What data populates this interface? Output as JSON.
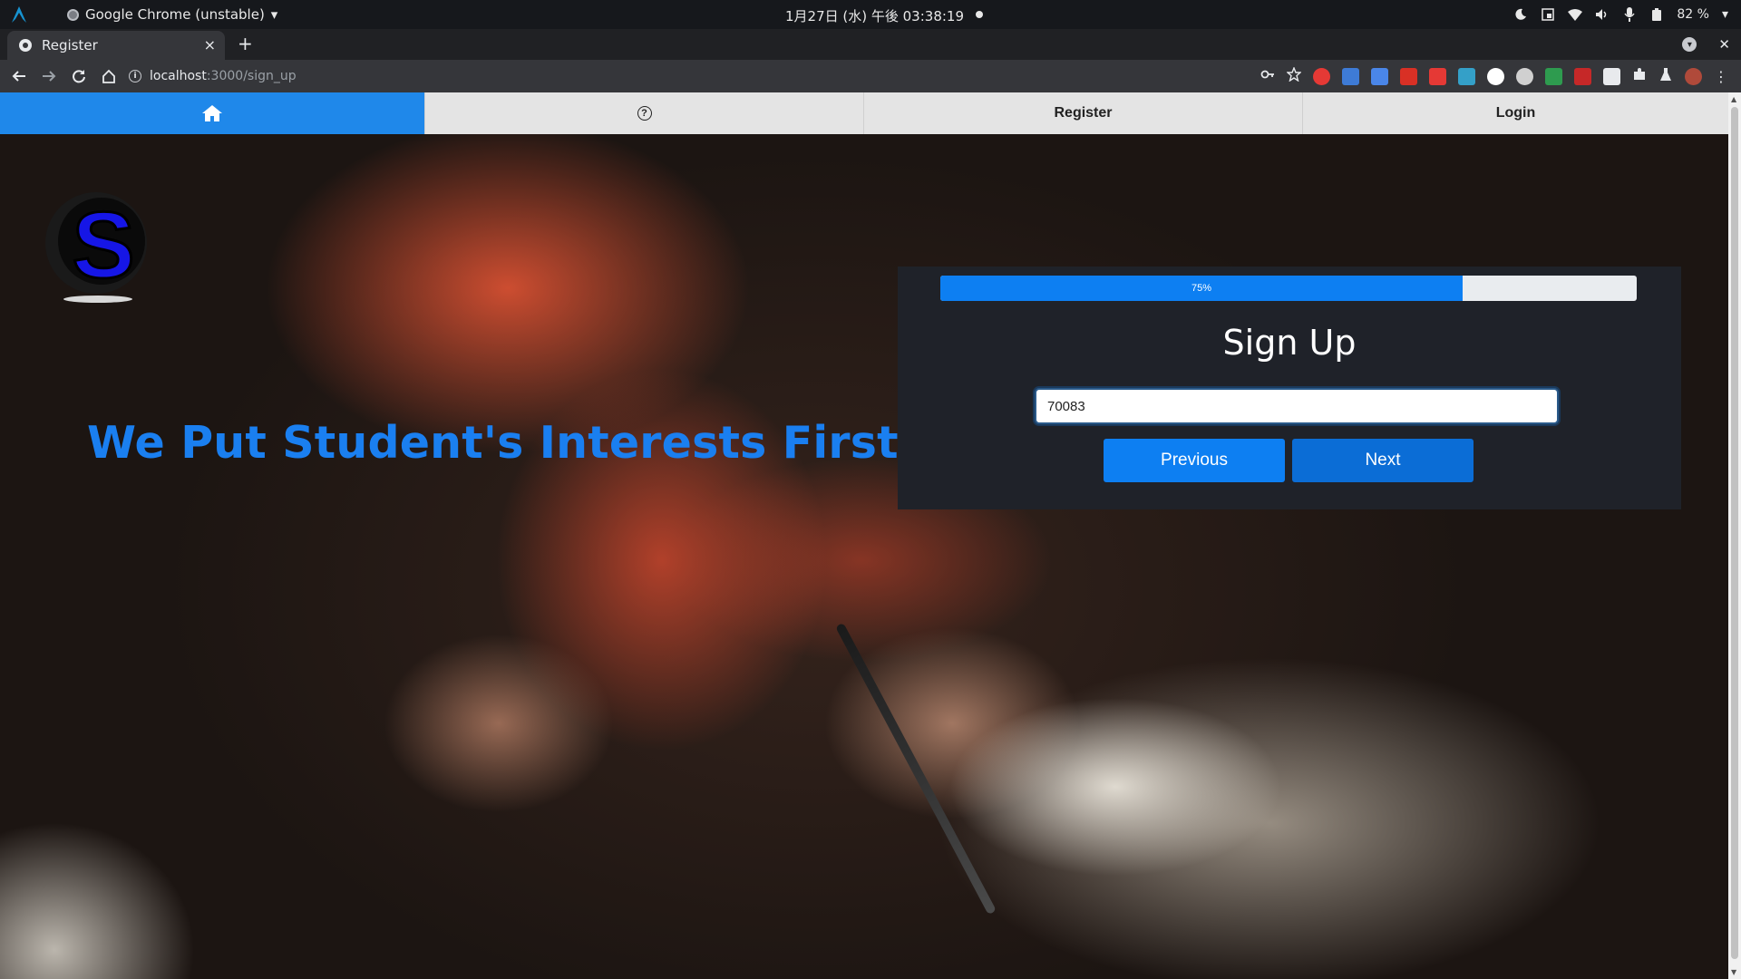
{
  "os_bar": {
    "app_name": "Google Chrome (unstable)",
    "app_dropdown": "▾",
    "clock": "1月27日 (水) 午後 03:38:19",
    "battery": "82 %",
    "battery_dropdown": "▾"
  },
  "browser": {
    "tab_title": "Register",
    "tab_close": "×",
    "new_tab": "+",
    "url_host": "localhost",
    "url_path": ":3000/sign_up",
    "extension_colors": [
      "#e53935",
      "#3e7bd6",
      "#4a86e8",
      "#d93025",
      "#e53935",
      "#34a0c8",
      "#ffffff",
      "#d0d0d0",
      "#2e9b4f",
      "#c62828",
      "#e8eaed",
      "#e8eaed",
      "#e8eaed"
    ]
  },
  "navbar": {
    "register_label": "Register",
    "login_label": "Login",
    "help_glyph": "?"
  },
  "hero": {
    "logo_letter": "S",
    "tagline": "We Put Student's Interests First"
  },
  "signup": {
    "progress_label": "75%",
    "progress_value": 0.75,
    "title": "Sign Up",
    "input_value": "70083",
    "previous_label": "Previous",
    "next_label": "Next"
  },
  "colors": {
    "accent": "#1f88ea",
    "tagline": "#1a7ff0",
    "card_bg": "#1f2229",
    "button": "#0d7ff2"
  }
}
